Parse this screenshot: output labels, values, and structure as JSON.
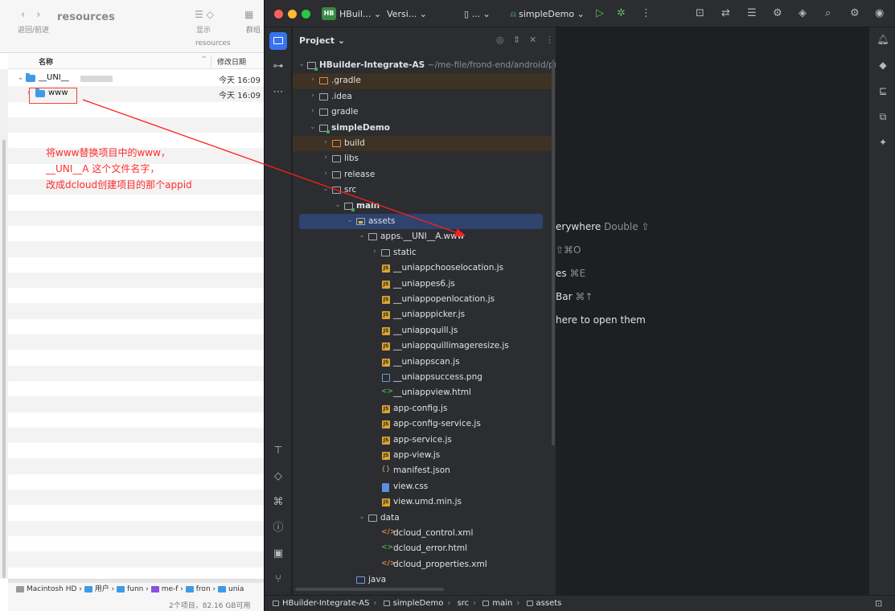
{
  "finder": {
    "nav_label": "返回/前进",
    "title": "resources",
    "view_label": "显示",
    "group_label": "群组",
    "path_title": "resources",
    "col_name": "名称",
    "col_date": "修改日期",
    "rows": [
      {
        "name": "__UNI__",
        "date": "今天 16:09"
      },
      {
        "name": "www",
        "date": "今天 16:09"
      }
    ],
    "crumbs": [
      "Macintosh HD",
      "用户",
      "funn",
      "me-f",
      "fron",
      "unia"
    ],
    "status": "2个项目，82.16 GB可用"
  },
  "annotation": {
    "line1": "将www替换项目中的www，",
    "line2": "__UNI__A 这个文件名字，",
    "line3": "改成dcloud创建项目的那个appid"
  },
  "ide": {
    "project_badge": "HB",
    "project_name": "HBuil...",
    "vcs_label": "Versi...",
    "device_label": "...",
    "run_config": "simpleDemo",
    "panel_title": "Project",
    "tree": {
      "root_name": "HBuilder-Integrate-AS",
      "root_path": "~/me-file/frond-end/android/proj",
      "gradle_dot": ".gradle",
      "idea": ".idea",
      "gradle": "gradle",
      "simple_demo": "simpleDemo",
      "build": "build",
      "libs": "libs",
      "release": "release",
      "src": "src",
      "main": "main",
      "assets": "assets",
      "apps": "apps.__UNI__A.www",
      "static": "static",
      "files": [
        "__uniappchooselocation.js",
        "__uniappes6.js",
        "__uniappopenlocation.js",
        "__uniapppicker.js",
        "__uniappquill.js",
        "__uniappquillimageresize.js",
        "__uniappscan.js",
        "__uniappsuccess.png",
        "__uniappview.html",
        "app-config.js",
        "app-config-service.js",
        "app-service.js",
        "app-view.js",
        "manifest.json",
        "view.css",
        "view.umd.min.js"
      ],
      "data": "data",
      "data_files": [
        "dcloud_control.xml",
        "dcloud_error.html",
        "dcloud_properties.xml"
      ],
      "java": "java"
    },
    "hints": [
      {
        "text": "erywhere",
        "key": "Double ⇧"
      },
      {
        "text": "",
        "key": "⇧⌘O"
      },
      {
        "text": "es",
        "key": "⌘E"
      },
      {
        "text": "Bar",
        "key": "⌘↑"
      },
      {
        "text": "here to open them",
        "key": ""
      }
    ],
    "statusbar": [
      "HBuilder-Integrate-AS",
      "simpleDemo",
      "src",
      "main",
      "assets"
    ]
  }
}
